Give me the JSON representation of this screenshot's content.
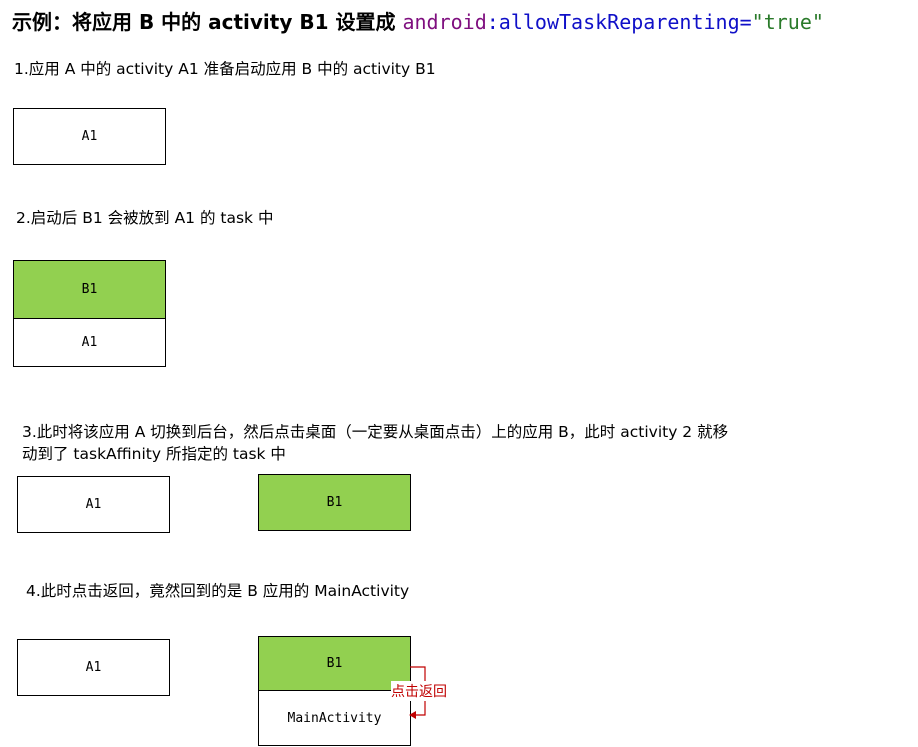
{
  "title": {
    "prefix": "示例：将应用 B 中的 activity B1 设置成 ",
    "attr_ns": "android",
    "attr_name": ":allowTaskReparenting",
    "equals": "=",
    "attr_value": "\"true\""
  },
  "steps": [
    {
      "text": "1.应用 A 中的 activity A1 准备启动应用 B 中的 activity B1"
    },
    {
      "text": "2.启动后 B1 会被放到 A1 的 task 中"
    },
    {
      "text_line1": "3.此时将该应用 A 切换到后台，然后点击桌面（一定要从桌面点击）上的应用 B，此时 activity 2 就移",
      "text_line2": "动到了 taskAffinity 所指定的 task 中"
    },
    {
      "text": "4.此时点击返回，竟然回到的是 B 应用的 MainActivity"
    }
  ],
  "diagrams": {
    "step1": {
      "box": "A1"
    },
    "step2": {
      "top": "B1",
      "bottom": "A1"
    },
    "step3": {
      "left": "A1",
      "right": "B1"
    },
    "step4": {
      "left": "A1",
      "stack_top": "B1",
      "stack_bottom": "MainActivity",
      "back_label": "点击返回"
    }
  },
  "colors": {
    "activity_green": "#92d050",
    "back_label": "#c00000",
    "back_arrow": "#c00000"
  }
}
